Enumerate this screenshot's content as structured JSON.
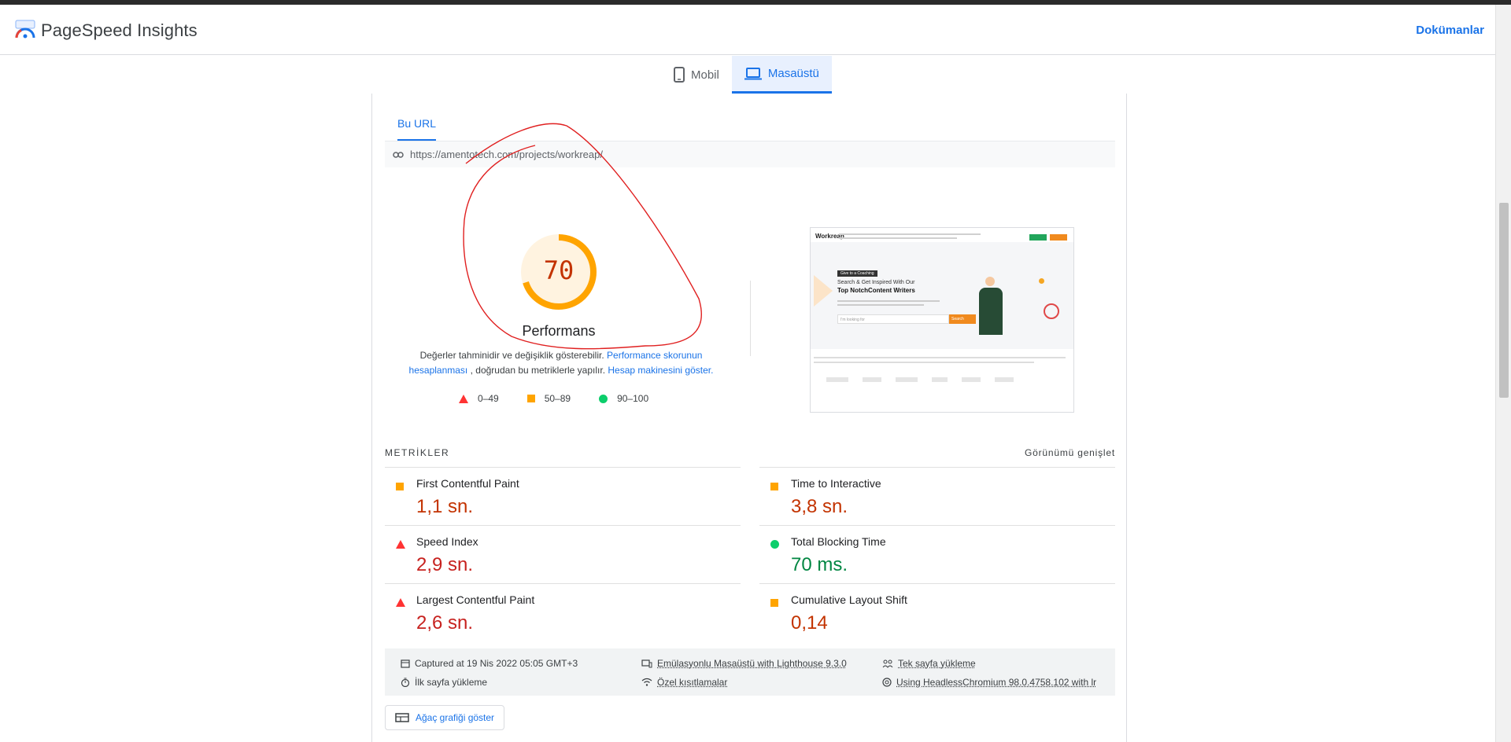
{
  "header": {
    "brand": "PageSpeed Insights",
    "docs_link": "Dokümanlar"
  },
  "device_tabs": [
    {
      "label": "Mobil",
      "icon": "phone-icon",
      "active": false
    },
    {
      "label": "Masaüstü",
      "icon": "laptop-icon",
      "active": true
    }
  ],
  "report": {
    "subtab": "Bu URL",
    "url": "https://amentotech.com/projects/workreap/",
    "score": "70",
    "score_fraction": 0.7,
    "category": "Performans",
    "note": {
      "text1": "Değerler tahminidir ve değişiklik gösterebilir.",
      "link1": "Performance skorunun hesaplanması",
      "text2": ", doğrudan bu metriklerle yapılır.",
      "link2": "Hesap makinesini göster."
    },
    "legend": [
      {
        "range": "0–49",
        "shape": "triangle",
        "color": "#ff3333"
      },
      {
        "range": "50–89",
        "shape": "square",
        "color": "#ffa400"
      },
      {
        "range": "90–100",
        "shape": "circle",
        "color": "#0cce6b"
      }
    ]
  },
  "screenshot": {
    "logo": "Workreap",
    "badge": "Give to a Coaching",
    "line1": "Search & Get Inspired With Our",
    "line2": "Top NotchContent Writers",
    "search_placeholder": "I'm looking for",
    "search_button": "Search"
  },
  "metrics": {
    "title": "METRİKLER",
    "expand": "Görünümü genişlet",
    "items": [
      {
        "name": "First Contentful Paint",
        "value": "1,1 sn.",
        "rating": "average"
      },
      {
        "name": "Time to Interactive",
        "value": "3,8 sn.",
        "rating": "average"
      },
      {
        "name": "Speed Index",
        "value": "2,9 sn.",
        "rating": "fail"
      },
      {
        "name": "Total Blocking Time",
        "value": "70 ms.",
        "rating": "pass"
      },
      {
        "name": "Largest Contentful Paint",
        "value": "2,6 sn.",
        "rating": "fail"
      },
      {
        "name": "Cumulative Layout Shift",
        "value": "0,14",
        "rating": "average"
      }
    ]
  },
  "runtime": {
    "captured": "Captured at 19 Nis 2022 05:05 GMT+3",
    "first_load": "İlk sayfa yükleme",
    "emulation": "Emülasyonlu Masaüstü with Lighthouse 9.3.0",
    "throttling": "Özel kısıtlamalar",
    "single_page": "Tek sayfa yükleme",
    "browser": "Using HeadlessChromium 98.0.4758.102 with lr"
  },
  "treemap_button": "Ağaç grafiği göster",
  "colors": {
    "accent": "#1a73e8",
    "fail": "#c7221f",
    "average": "#c33300",
    "pass": "#018642",
    "annotation": "#e02020"
  }
}
